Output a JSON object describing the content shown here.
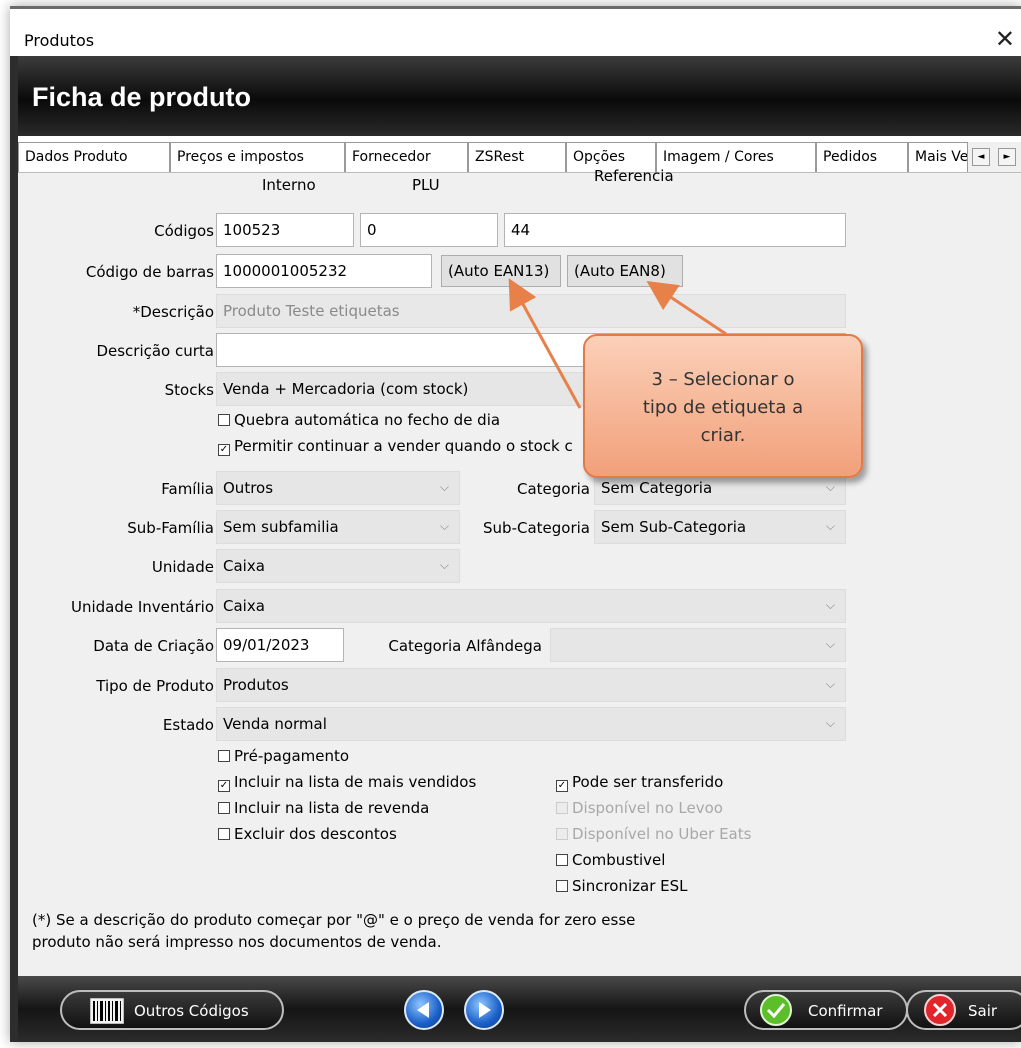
{
  "window": {
    "title": "Produtos",
    "close_icon": "close-icon"
  },
  "banner": {
    "title": "Ficha de produto"
  },
  "tabs": [
    {
      "label": "Dados Produto"
    },
    {
      "label": "Preços e impostos"
    },
    {
      "label": "Fornecedor"
    },
    {
      "label": "ZSRest"
    },
    {
      "label": "Opções"
    },
    {
      "label": "Imagem / Cores"
    },
    {
      "label": "Pedidos"
    },
    {
      "label": "Mais Ve"
    }
  ],
  "form": {
    "col_interno": "Interno",
    "col_plu": "PLU",
    "col_referencia": "Referencia",
    "codigos_label": "Códigos",
    "interno_value": "100523",
    "plu_value": "0",
    "referencia_value": "44",
    "barras_label": "Código de barras",
    "barras_value": "1000001005232",
    "auto_ean13": "(Auto EAN13)",
    "auto_ean8": "(Auto EAN8)",
    "descricao_label": "*Descrição",
    "descricao_value": "Produto Teste etiquetas",
    "descricao_curta_label": "Descrição curta",
    "descricao_curta_value": "",
    "stocks_label": "Stocks",
    "stocks_value": "Venda + Mercadoria (com stock)",
    "quebra_label": "Quebra automática no fecho de dia",
    "permitir_label": "Permitir continuar a vender quando o stock c",
    "familia_label": "Família",
    "familia_value": "Outros",
    "categoria_label": "Categoria",
    "categoria_value": "Sem Categoria",
    "subfamilia_label": "Sub-Família",
    "subfamilia_value": "Sem subfamilia",
    "subcategoria_label": "Sub-Categoria",
    "subcategoria_value": "Sem Sub-Categoria",
    "unidade_label": "Unidade",
    "unidade_value": "Caixa",
    "unidade_inv_label": "Unidade Inventário",
    "unidade_inv_value": "Caixa",
    "data_label": "Data de Criação",
    "data_value": "09/01/2023",
    "cat_alfandega_label": "Categoria Alfândega",
    "cat_alfandega_value": "",
    "tipo_label": "Tipo de Produto",
    "tipo_value": "Produtos",
    "estado_label": "Estado",
    "estado_value": "Venda normal",
    "pre_pagamento": "Pré-pagamento",
    "incluir_mais_vendidos": "Incluir na lista de mais vendidos",
    "incluir_revenda": "Incluir na lista de revenda",
    "excluir_descontos": "Excluir dos descontos",
    "pode_transferido": "Pode ser transferido",
    "disp_levoo": "Disponível no Levoo",
    "disp_uber": "Disponível no Uber Eats",
    "combustivel": "Combustivel",
    "sincronizar_esl": "Sincronizar ESL",
    "note_line1": "(*) Se a descrição do produto começar por \"@\" e o preço de venda for zero  esse",
    "note_line2": "produto não será impresso nos documentos de venda."
  },
  "footer": {
    "outros_codigos": "Outros Códigos",
    "confirmar": "Confirmar",
    "sair": "Sair"
  },
  "callout": {
    "line1": "3 – Selecionar o",
    "line2": "tipo de etiqueta a",
    "line3": "criar."
  },
  "colors": {
    "callout_fill": "#f4b08c",
    "callout_border": "#e07a48",
    "arrow": "#e8804a"
  }
}
